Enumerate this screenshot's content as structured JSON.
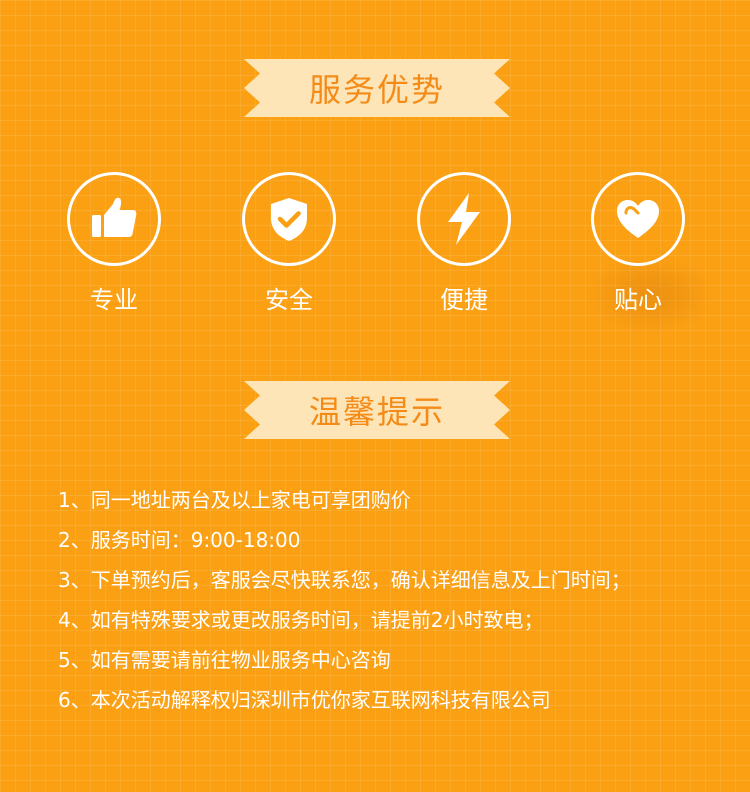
{
  "section_service": {
    "title": "服务优势"
  },
  "features": [
    {
      "label": "专业",
      "icon": "thumbs-up-icon"
    },
    {
      "label": "安全",
      "icon": "shield-check-icon"
    },
    {
      "label": "便捷",
      "icon": "lightning-icon"
    },
    {
      "label": "贴心",
      "icon": "heart-icon"
    }
  ],
  "section_tips": {
    "title": "温馨提示"
  },
  "tips": [
    "1、同一地址两台及以上家电可享团购价",
    "2、服务时间：9:00-18:00",
    "3、下单预约后，客服会尽快联系您，确认详细信息及上门时间；",
    "4、如有特殊要求或更改服务时间，请提前2小时致电；",
    "5、如有需要请前往物业服务中心咨询",
    "6、本次活动解释权归深圳市优你家互联网科技有限公司"
  ],
  "colors": {
    "background": "#fb9f13",
    "banner_fill": "#fde5b8",
    "banner_text": "#f48b17",
    "text": "#ffffff"
  }
}
